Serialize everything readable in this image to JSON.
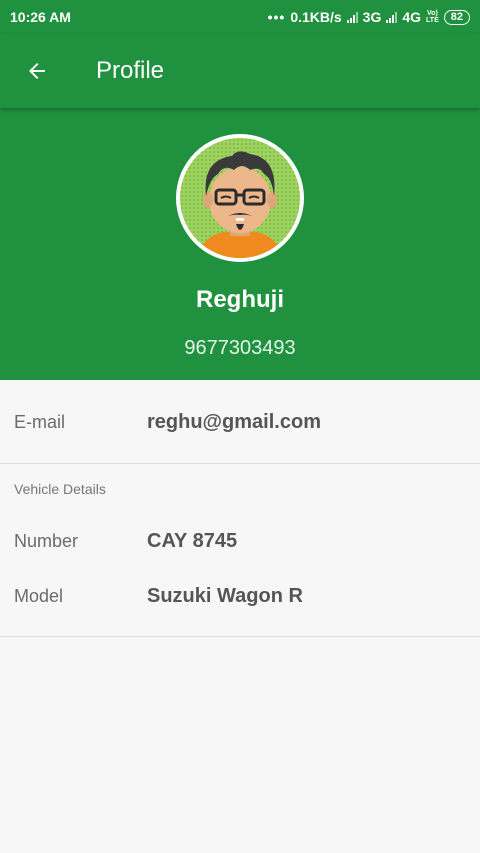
{
  "status_bar": {
    "time": "10:26 AM",
    "dots": "•••",
    "speed": "0.1KB/s",
    "net1": "3G",
    "net2": "4G",
    "volte_top": "Vo)",
    "volte_bottom": "LTE",
    "battery": "82",
    "icons": [
      "signal-icon",
      "signal-icon",
      "volte-icon",
      "battery-icon"
    ]
  },
  "app_bar": {
    "back_icon": "arrow-left-icon",
    "title": "Profile"
  },
  "profile": {
    "name": "Reghuji",
    "phone": "9677303493"
  },
  "email": {
    "label": "E-mail",
    "value": "reghu@gmail.com"
  },
  "vehicle": {
    "section_title": "Vehicle Details",
    "number_label": "Number",
    "number_value": "CAY 8745",
    "model_label": "Model",
    "model_value": "Suzuki Wagon R"
  },
  "colors": {
    "primary": "#20913f",
    "background": "#f7f7f7",
    "divider": "#dcdcdc"
  }
}
